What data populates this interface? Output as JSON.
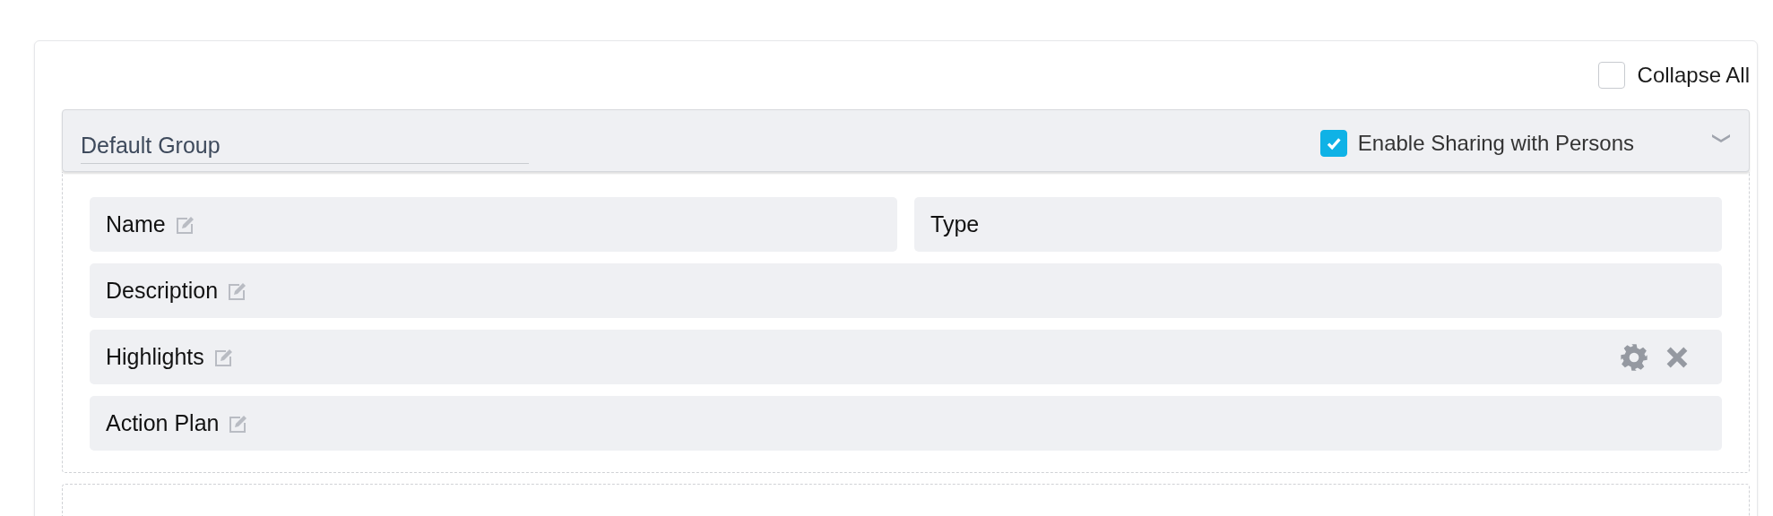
{
  "collapse_all": {
    "label": "Collapse All",
    "checked": false
  },
  "group": {
    "name": "Default Group",
    "sharing": {
      "label": "Enable Sharing with Persons",
      "checked": true
    },
    "expanded": true,
    "rows": [
      {
        "fields": [
          {
            "label": "Name",
            "editable": true,
            "tools": false
          },
          {
            "label": "Type",
            "editable": false,
            "tools": false
          }
        ]
      },
      {
        "fields": [
          {
            "label": "Description",
            "editable": true,
            "tools": false
          }
        ]
      },
      {
        "fields": [
          {
            "label": "Highlights",
            "editable": true,
            "tools": true
          }
        ]
      },
      {
        "fields": [
          {
            "label": "Action Plan",
            "editable": true,
            "tools": false
          }
        ]
      }
    ]
  }
}
